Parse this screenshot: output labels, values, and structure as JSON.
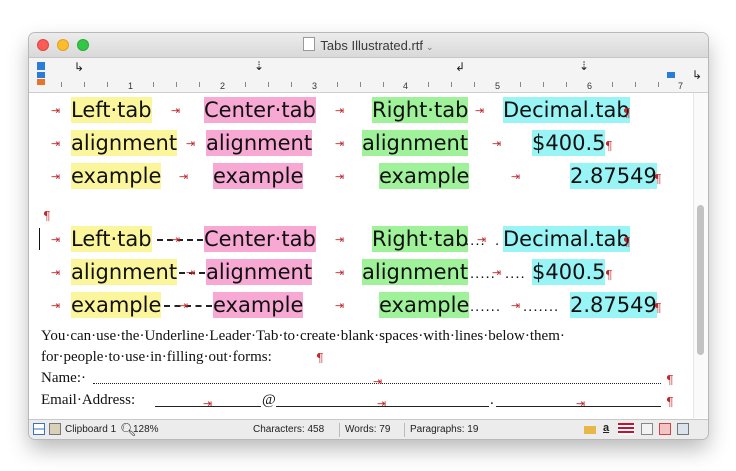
{
  "window": {
    "title": "Tabs Illustrated.rtf"
  },
  "ruler": {
    "numbers": [
      "1",
      "2",
      "3",
      "4",
      "5",
      "6",
      "7"
    ]
  },
  "table1": {
    "rows": [
      {
        "left": "Left·tab",
        "center": "Center·tab",
        "right": "Right·tab",
        "decimal": "Decimal.tab"
      },
      {
        "left": "alignment",
        "center": "alignment",
        "right": "alignment",
        "decimal": "$400.5"
      },
      {
        "left": "example",
        "center": "example",
        "right": "example",
        "decimal": "2.87549"
      }
    ]
  },
  "table2": {
    "rows": [
      {
        "left": "Left·tab",
        "center": "Center·tab",
        "right": "Right·tab",
        "decimal": "Decimal.tab",
        "leader": "....",
        "leader2": "."
      },
      {
        "left": "alignment",
        "center": "alignment",
        "right": "alignment",
        "decimal": "$400.5",
        "leader": ".....",
        "leader2": "...."
      },
      {
        "left": "example",
        "center": "example",
        "right": "example",
        "decimal": "2.87549",
        "leader": "......",
        "leader2": "......."
      }
    ]
  },
  "symbols": {
    "tab_arrow": "⇥",
    "pilcrow": "¶"
  },
  "paragraph": {
    "line1": "You·can·use·the·Underline·Leader·Tab·to·create·blank·spaces·with·lines·below·them·",
    "line2": "for·people·to·use·in·filling·out·forms:"
  },
  "form": {
    "name_label": "Name:·",
    "email_label": "Email·Address:",
    "at_sign": "@",
    "dot": "."
  },
  "status": {
    "clipboard": "Clipboard 1",
    "zoom": "128%",
    "characters": "Characters: 458",
    "words": "Words: 79",
    "paragraphs": "Paragraphs: 19"
  },
  "colors": {
    "left": "#fbf69c",
    "center": "#f7a9d3",
    "right": "#9ff29a",
    "decimal": "#99f4f6",
    "markers": "#c0282b"
  }
}
